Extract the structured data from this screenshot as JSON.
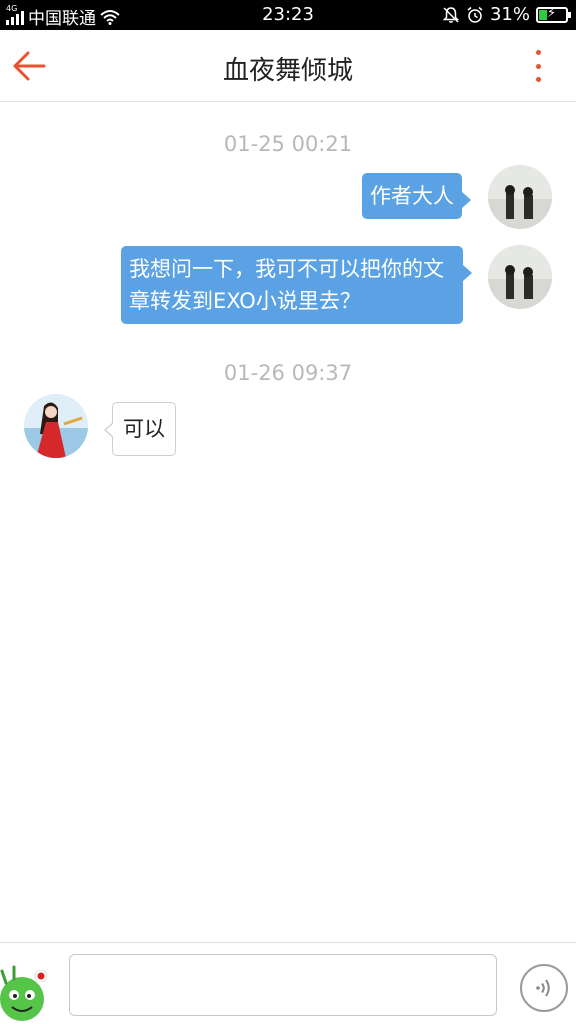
{
  "status_bar": {
    "network": "4G",
    "carrier": "中国联通",
    "time": "23:23",
    "battery_percent": "31%",
    "battery_level": 0.31,
    "icons": [
      "signal-icon",
      "wifi-icon",
      "mute-icon",
      "alarm-icon",
      "battery-icon"
    ]
  },
  "header": {
    "title": "血夜舞倾城",
    "back_icon": "back-arrow-icon",
    "more_icon": "more-vertical-icon"
  },
  "conversation": {
    "groups": [
      {
        "timestamp": "01-25 00:21",
        "messages": [
          {
            "direction": "outgoing",
            "text": "作者大人"
          },
          {
            "direction": "outgoing",
            "text": "我想问一下，我可不可以把你的文章转发到EXO小说里去？"
          }
        ]
      },
      {
        "timestamp": "01-26 09:37",
        "messages": [
          {
            "direction": "incoming",
            "text": "可以"
          }
        ]
      }
    ]
  },
  "input_bar": {
    "emoji_icon": "emoji-sticker-icon",
    "input_value": "",
    "voice_icon": "voice-icon"
  },
  "colors": {
    "accent": "#e8532e",
    "outgoing_bubble": "#5aa2e3",
    "timestamp": "#b8b8b8",
    "status_bar_bg": "#000000",
    "battery_fill": "#2ecc40"
  }
}
